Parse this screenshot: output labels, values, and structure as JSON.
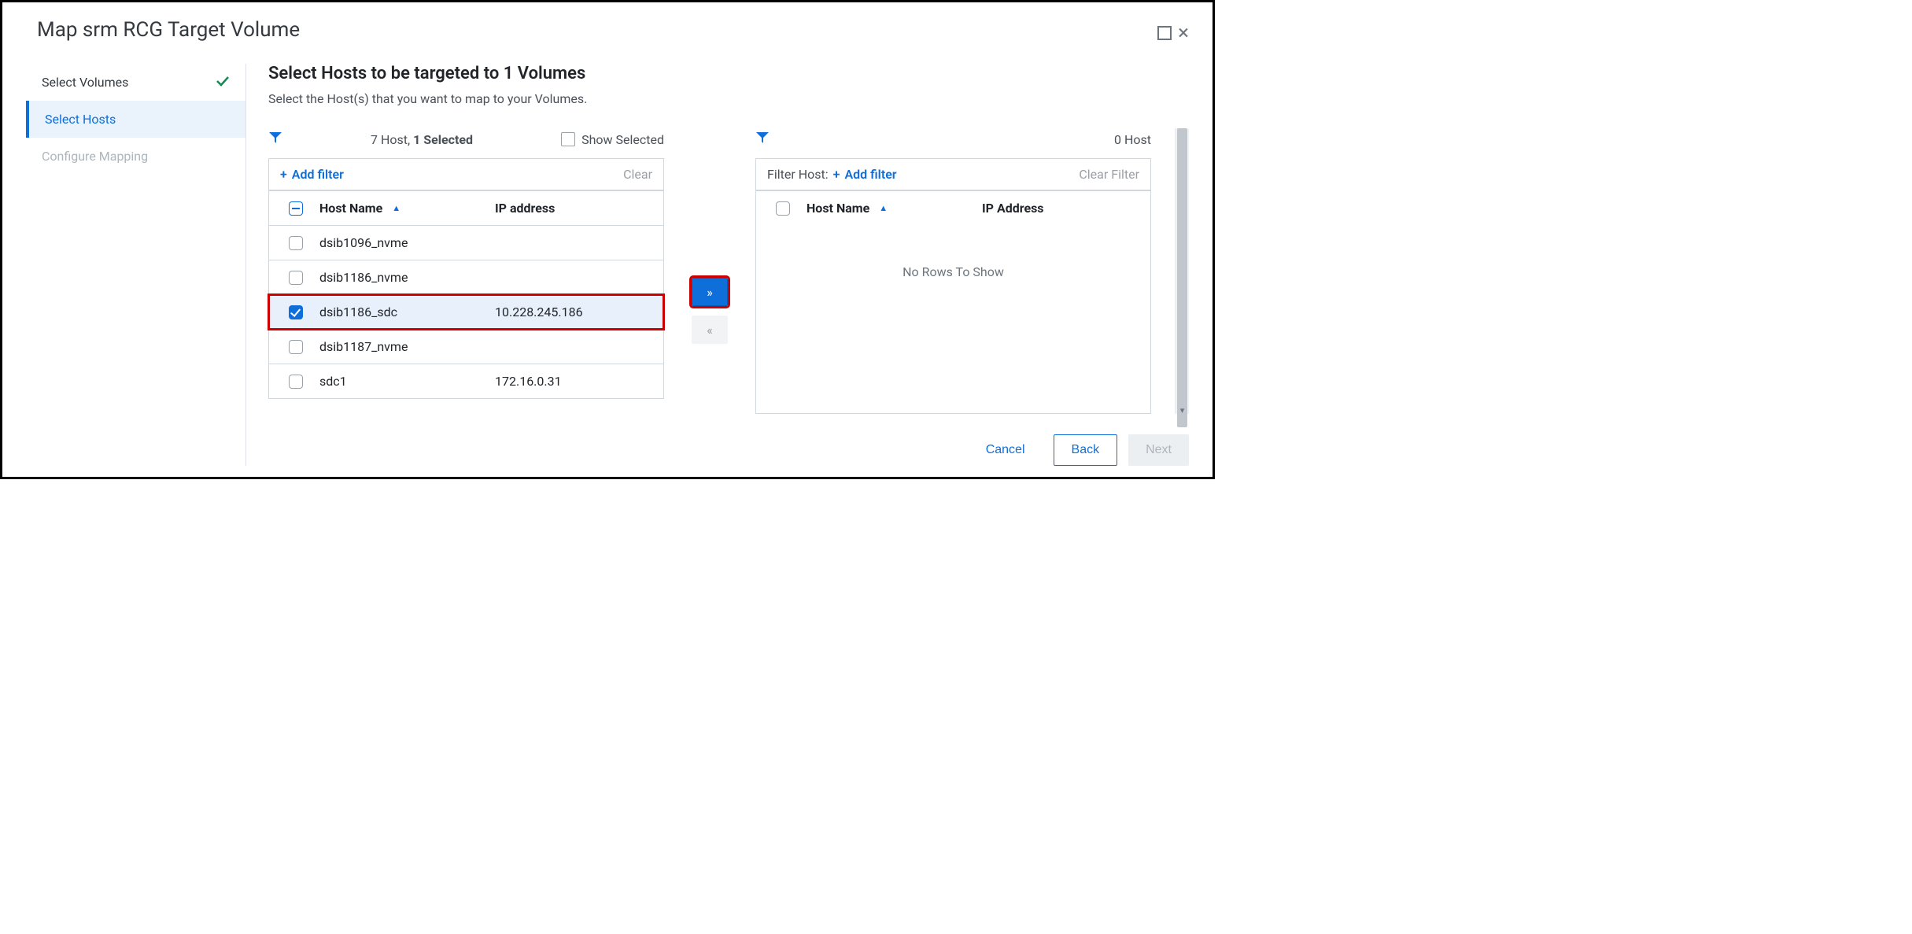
{
  "dialog": {
    "title": "Map srm RCG Target Volume"
  },
  "steps": {
    "select_volumes": "Select Volumes",
    "select_hosts": "Select Hosts",
    "configure_mapping": "Configure Mapping"
  },
  "main": {
    "heading": "Select Hosts to be targeted to 1 Volumes",
    "subtitle": "Select the Host(s) that you want to map to your Volumes."
  },
  "left_panel": {
    "count_text_a": "7 Host, ",
    "count_text_b": "1 Selected",
    "show_selected": "Show Selected",
    "add_filter": "Add filter",
    "clear": "Clear",
    "col_host": "Host Name",
    "col_ip": "IP address",
    "rows": [
      {
        "name": "dsib1096_nvme",
        "ip": "",
        "checked": false
      },
      {
        "name": "dsib1186_nvme",
        "ip": "",
        "checked": false
      },
      {
        "name": "dsib1186_sdc",
        "ip": "10.228.245.186",
        "checked": true
      },
      {
        "name": "dsib1187_nvme",
        "ip": "",
        "checked": false
      },
      {
        "name": "sdc1",
        "ip": "172.16.0.31",
        "checked": false
      }
    ]
  },
  "right_panel": {
    "count_text": "0 Host",
    "filter_label": "Filter Host:",
    "add_filter": "Add filter",
    "clear": "Clear Filter",
    "col_host": "Host Name",
    "col_ip": "IP Address",
    "no_rows": "No Rows To Show"
  },
  "footer": {
    "cancel": "Cancel",
    "back": "Back",
    "next": "Next"
  }
}
